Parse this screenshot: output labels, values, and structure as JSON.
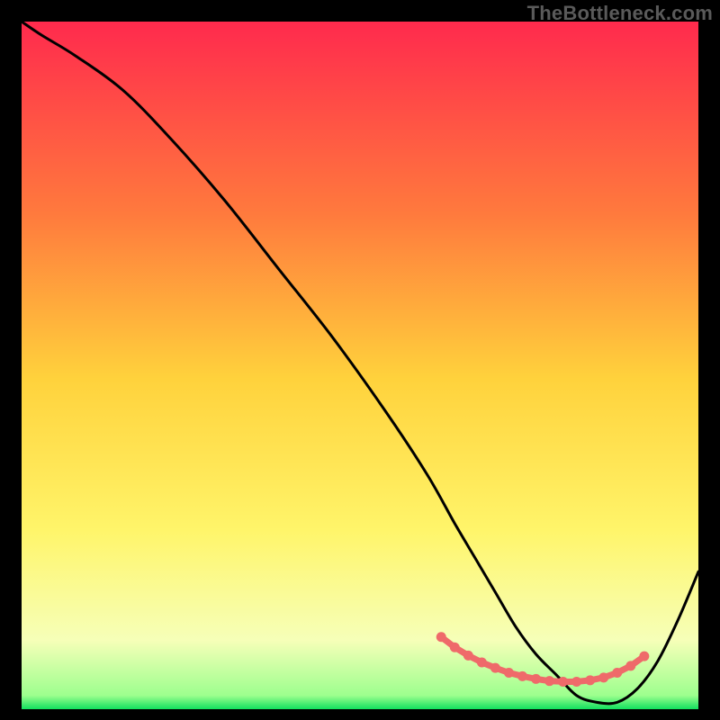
{
  "watermark": "TheBottleneck.com",
  "colors": {
    "bg": "#000000",
    "grad_top": "#ff2a4d",
    "grad_mid_upper": "#ff7a3d",
    "grad_mid": "#ffd23c",
    "grad_mid_lower": "#fff56a",
    "grad_low": "#f6ffb8",
    "grad_bottom": "#11e05e",
    "curve": "#000000",
    "marker": "#ef6a6a"
  },
  "chart_data": {
    "type": "line",
    "title": "",
    "xlabel": "",
    "ylabel": "",
    "xlim": [
      0,
      100
    ],
    "ylim": [
      0,
      100
    ],
    "series": [
      {
        "name": "bottleneck-curve",
        "x": [
          0,
          3,
          8,
          15,
          22,
          30,
          38,
          46,
          54,
          60,
          64,
          67,
          70,
          73,
          76,
          79,
          82,
          85,
          88,
          91,
          94,
          97,
          100
        ],
        "y": [
          100,
          98,
          95,
          90,
          83,
          74,
          64,
          54,
          43,
          34,
          27,
          22,
          17,
          12,
          8,
          5,
          2,
          1,
          1,
          3,
          7,
          13,
          20
        ]
      }
    ],
    "markers": {
      "name": "optimal-zone",
      "x": [
        62,
        64,
        66,
        68,
        70,
        72,
        74,
        76,
        78,
        80,
        82,
        84,
        86,
        88,
        90,
        92
      ],
      "y": [
        10.5,
        9.0,
        7.8,
        6.8,
        6.0,
        5.3,
        4.8,
        4.4,
        4.1,
        4.0,
        4.0,
        4.2,
        4.6,
        5.3,
        6.3,
        7.7
      ]
    }
  }
}
